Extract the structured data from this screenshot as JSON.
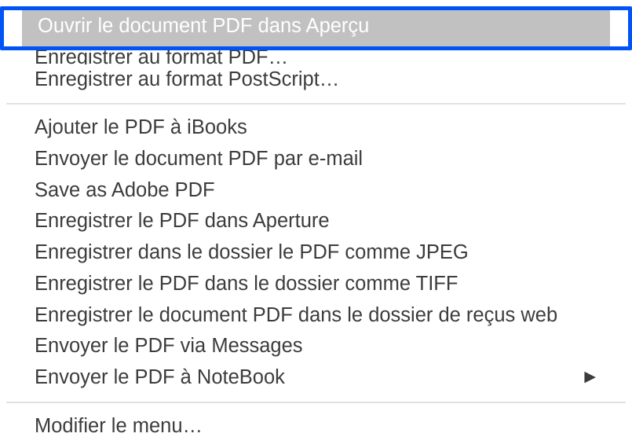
{
  "highlight": "Ouvrir le document PDF dans Aperçu",
  "top": {
    "partial": "Enregistrer au format PDF…",
    "item2": "Enregistrer au format PostScript…"
  },
  "main": {
    "items": [
      "Ajouter le PDF à iBooks",
      "Envoyer le document PDF par e-mail",
      "Save as Adobe PDF",
      "Enregistrer le PDF dans Aperture",
      "Enregistrer dans le dossier le PDF comme JPEG",
      "Enregistrer le PDF dans le dossier comme TIFF",
      "Enregistrer le document PDF dans le dossier de reçus web",
      "Envoyer le PDF via Messages",
      "Envoyer le PDF à NoteBook"
    ]
  },
  "bottom": {
    "edit": "Modifier le menu…"
  }
}
